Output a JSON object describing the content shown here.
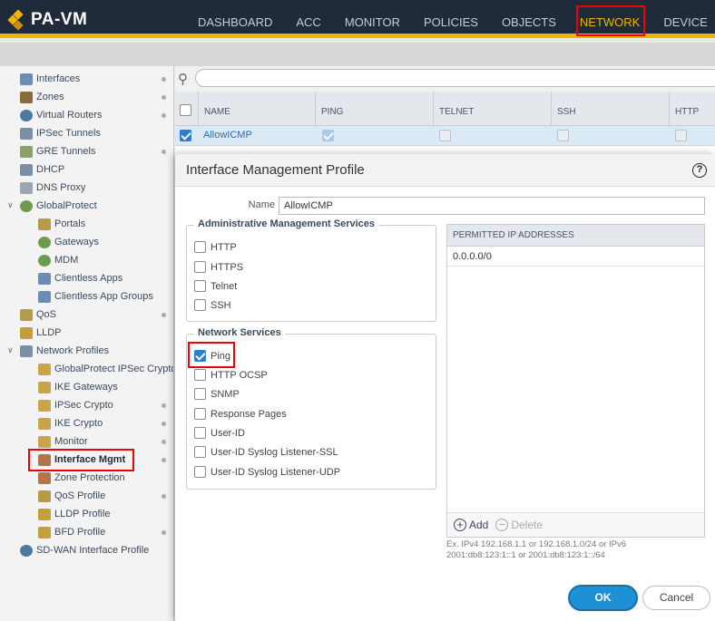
{
  "app": {
    "logo": "PA-VM"
  },
  "nav": {
    "items": [
      "DASHBOARD",
      "ACC",
      "MONITOR",
      "POLICIES",
      "OBJECTS",
      "NETWORK",
      "DEVICE"
    ],
    "active": "NETWORK"
  },
  "sidebar": {
    "items": [
      {
        "label": "Interfaces",
        "icon": "interfaces-icon"
      },
      {
        "label": "Zones",
        "icon": "zones-icon"
      },
      {
        "label": "Virtual Routers",
        "icon": "virtual-router-icon"
      },
      {
        "label": "IPSec Tunnels",
        "icon": "ipsec-tunnel-icon"
      },
      {
        "label": "GRE Tunnels",
        "icon": "gre-tunnel-icon"
      },
      {
        "label": "DHCP",
        "icon": "dhcp-icon"
      },
      {
        "label": "DNS Proxy",
        "icon": "dns-proxy-icon"
      },
      {
        "label": "GlobalProtect",
        "icon": "globalprotect-icon"
      },
      {
        "label": "Portals",
        "icon": "portals-icon"
      },
      {
        "label": "Gateways",
        "icon": "gateways-icon"
      },
      {
        "label": "MDM",
        "icon": "mdm-icon"
      },
      {
        "label": "Clientless Apps",
        "icon": "clientless-apps-icon"
      },
      {
        "label": "Clientless App Groups",
        "icon": "clientless-app-groups-icon"
      },
      {
        "label": "QoS",
        "icon": "qos-icon"
      },
      {
        "label": "LLDP",
        "icon": "lldp-icon"
      },
      {
        "label": "Network Profiles",
        "icon": "network-profiles-icon"
      },
      {
        "label": "GlobalProtect IPSec Crypto",
        "icon": "lock-icon"
      },
      {
        "label": "IKE Gateways",
        "icon": "lock-icon"
      },
      {
        "label": "IPSec Crypto",
        "icon": "lock-icon"
      },
      {
        "label": "IKE Crypto",
        "icon": "lock-icon"
      },
      {
        "label": "Monitor",
        "icon": "lock-icon"
      },
      {
        "label": "Interface Mgmt",
        "icon": "interface-mgmt-icon"
      },
      {
        "label": "Zone Protection",
        "icon": "shield-icon"
      },
      {
        "label": "QoS Profile",
        "icon": "qos-profile-icon"
      },
      {
        "label": "LLDP Profile",
        "icon": "lldp-profile-icon"
      },
      {
        "label": "BFD Profile",
        "icon": "bfd-profile-icon"
      },
      {
        "label": "SD-WAN Interface Profile",
        "icon": "sdwan-icon"
      }
    ]
  },
  "table": {
    "columns": [
      "NAME",
      "PING",
      "TELNET",
      "SSH",
      "HTTP"
    ],
    "rows": [
      {
        "name": "AllowICMP",
        "ping": true,
        "telnet": false,
        "ssh": false,
        "http": false
      }
    ]
  },
  "modal": {
    "title": "Interface Management Profile",
    "name_label": "Name",
    "name_value": "AllowICMP",
    "admin_legend": "Administrative Management Services",
    "admin_options": [
      {
        "label": "HTTP",
        "checked": false
      },
      {
        "label": "HTTPS",
        "checked": false
      },
      {
        "label": "Telnet",
        "checked": false
      },
      {
        "label": "SSH",
        "checked": false
      }
    ],
    "network_legend": "Network Services",
    "network_options": [
      {
        "label": "Ping",
        "checked": true
      },
      {
        "label": "HTTP OCSP",
        "checked": false
      },
      {
        "label": "SNMP",
        "checked": false
      },
      {
        "label": "Response Pages",
        "checked": false
      },
      {
        "label": "User-ID",
        "checked": false
      },
      {
        "label": "User-ID Syslog Listener-SSL",
        "checked": false
      },
      {
        "label": "User-ID Syslog Listener-UDP",
        "checked": false
      }
    ],
    "ip_header": "PERMITTED IP ADDRESSES",
    "ip_rows": [
      "0.0.0.0/0"
    ],
    "add_label": "Add",
    "delete_label": "Delete",
    "hint_line1": "Ex. IPv4 192.168.1.1 or 192.168.1.0/24 or IPv6",
    "hint_line2": "2001:db8:123:1::1 or 2001:db8:123:1::/64",
    "ok_label": "OK",
    "cancel_label": "Cancel"
  },
  "colors": {
    "accent": "#f0b400",
    "topbar": "#1f2b3a",
    "primary_button": "#1e90d6",
    "highlight": "#e00000"
  }
}
